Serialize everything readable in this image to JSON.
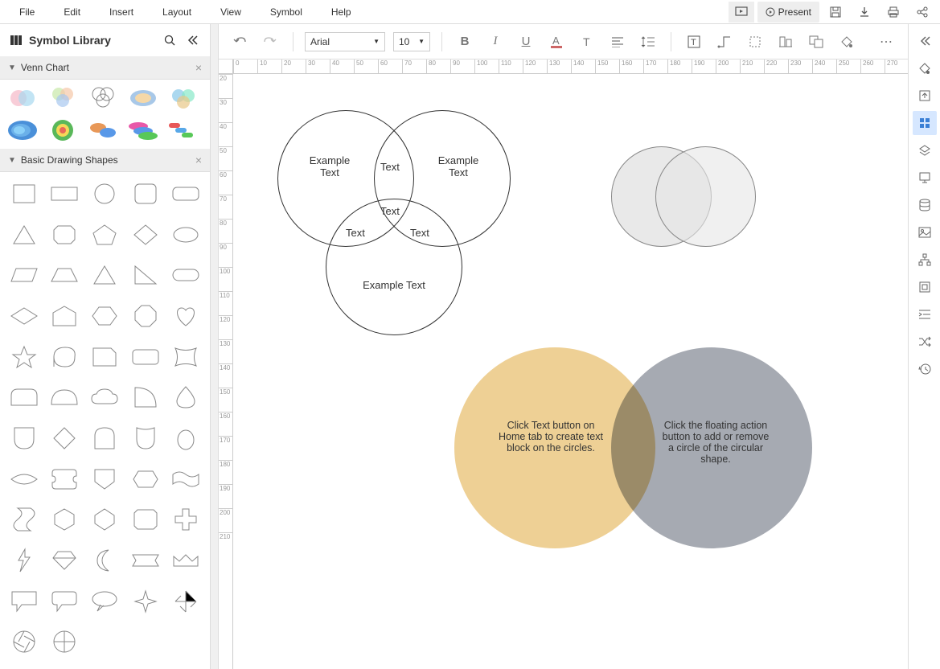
{
  "menu": {
    "items": [
      "File",
      "Edit",
      "Insert",
      "Layout",
      "View",
      "Symbol",
      "Help"
    ]
  },
  "present_label": "Present",
  "sidebar": {
    "title": "Symbol Library"
  },
  "panels": {
    "venn": {
      "title": "Venn Chart"
    },
    "basic": {
      "title": "Basic Drawing Shapes"
    }
  },
  "toolbar": {
    "font": "Arial",
    "size": "10"
  },
  "ruler_h": [
    "0",
    "10",
    "20",
    "30",
    "40",
    "50",
    "60",
    "70",
    "80",
    "90",
    "100",
    "110",
    "120",
    "130",
    "140",
    "150",
    "160",
    "170",
    "180",
    "190",
    "200",
    "210",
    "220",
    "230",
    "240",
    "250",
    "260",
    "270"
  ],
  "ruler_v": [
    "20",
    "30",
    "40",
    "50",
    "60",
    "70",
    "80",
    "90",
    "100",
    "110",
    "120",
    "130",
    "140",
    "150",
    "160",
    "170",
    "180",
    "190",
    "200",
    "210"
  ],
  "venn3": {
    "c1": "Example Text",
    "c2": "Example Text",
    "c3": "Example Text",
    "i12": "Text",
    "i13": "Text",
    "i23": "Text",
    "i123": "Text"
  },
  "venn2": {
    "left": "Click Text button on Home tab to create text block on the circles.",
    "right": "Click the floating action button to add or remove a circle of the circular shape."
  }
}
